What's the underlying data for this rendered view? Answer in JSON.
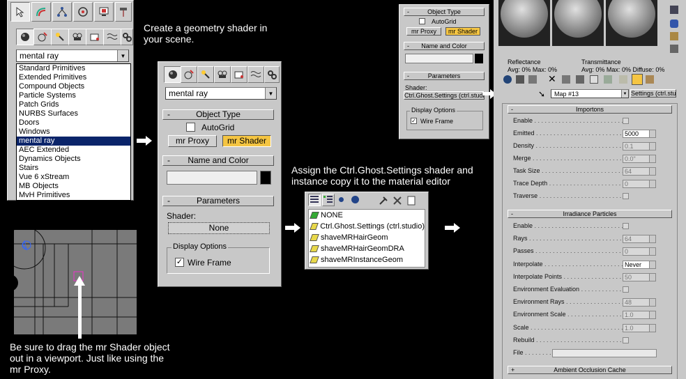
{
  "captions": {
    "top": "Create a geometry shader in your scene.",
    "assign": "Assign the Ctrl.Ghost.Settings shader and instance copy it to the material editor",
    "bottom": "Be sure to drag the mr Shader object out in a viewport.  Just like using the mr Proxy."
  },
  "left_panel": {
    "dropdown_value": "mental ray",
    "categories": [
      "Standard Primitives",
      "Extended Primitives",
      "Compound Objects",
      "Particle Systems",
      "Patch Grids",
      "NURBS Surfaces",
      "Doors",
      "Windows",
      "mental ray",
      "AEC Extended",
      "Dynamics Objects",
      "Stairs",
      "Vue 6 xStream",
      "MB Objects",
      "MvH Primitives"
    ],
    "selected_index": 8
  },
  "mid_panel": {
    "dropdown_value": "mental ray",
    "object_type": {
      "title": "Object Type",
      "autogrid": "AutoGrid",
      "btn1": "mr Proxy",
      "btn2": "mr Shader"
    },
    "name_color": {
      "title": "Name and Color"
    },
    "parameters": {
      "title": "Parameters",
      "shader_label": "Shader:",
      "shader_value": "None"
    },
    "display": {
      "title": "Display Options",
      "wire": "Wire Frame",
      "wire_checked": "✓"
    },
    "minus": "-"
  },
  "browser": {
    "items": [
      "NONE",
      "Ctrl.Ghost.Settings (ctrl.studio)",
      "shaveMRHairGeom",
      "shaveMRHairGeomDRA",
      "shaveMRInstanceGeom"
    ]
  },
  "small_panel": {
    "object_type": "Object Type",
    "autogrid": "AutoGrid",
    "btn1": "mr Proxy",
    "btn2": "mr Shader",
    "name_color": "Name and Color",
    "parameters": "Parameters",
    "shader_label": "Shader:",
    "shader_value": "Ctrl.Ghost.Settings (ctrl.studio) ]",
    "display": "Display Options",
    "wire": "Wire Frame",
    "wire_checked": "✓",
    "minus": "-"
  },
  "material_editor": {
    "reflectance": "Reflectance",
    "transmittance": "Transmittance",
    "refl_avg": "Avg:",
    "refl_avg_v": "0%",
    "refl_max": "Max:",
    "refl_max_v": "0%",
    "trans_avg": "Avg:",
    "trans_avg_v": "0%",
    "trans_max": "Max:",
    "trans_max_v": "0%",
    "diffuse": "Diffuse:",
    "diffuse_v": "0%",
    "map_name": "Map #13",
    "map_type": "Settings (ctrl.studio)",
    "importons_title": "Importons",
    "importons": [
      {
        "label": "Enable",
        "type": "check"
      },
      {
        "label": "Emitted",
        "type": "spin",
        "value": "5000",
        "white": true
      },
      {
        "label": "Density",
        "type": "spin",
        "value": "0.1"
      },
      {
        "label": "Merge",
        "type": "spin",
        "value": "0.0\""
      },
      {
        "label": "Task Size",
        "type": "spin",
        "value": "64"
      },
      {
        "label": "Trace Depth",
        "type": "spin",
        "value": "0"
      },
      {
        "label": "Traverse",
        "type": "check"
      }
    ],
    "irr_title": "Irradiance Particles",
    "irr": [
      {
        "label": "Enable",
        "type": "check"
      },
      {
        "label": "Rays",
        "type": "spin",
        "value": "64"
      },
      {
        "label": "Passes",
        "type": "spin",
        "value": "0"
      },
      {
        "label": "Interpolate",
        "type": "drop",
        "value": "Never"
      },
      {
        "label": "Interpolate Points",
        "type": "spin",
        "value": "50"
      },
      {
        "label": "Environment Evaluation",
        "type": "check"
      },
      {
        "label": "Environment Rays",
        "type": "spin",
        "value": "48"
      },
      {
        "label": "Environment Scale",
        "type": "spin",
        "value": "1.0"
      },
      {
        "label": "Scale",
        "type": "spin",
        "value": "1.0"
      },
      {
        "label": "Rebuild",
        "type": "check"
      },
      {
        "label": "File",
        "type": "file"
      }
    ],
    "ao_title": "Ambient Occlusion Cache",
    "minus": "-",
    "plus": "+"
  },
  "colors": {
    "panel": "#c8c8c8",
    "selection": "#0a246a",
    "active_button": "#f5c542"
  }
}
